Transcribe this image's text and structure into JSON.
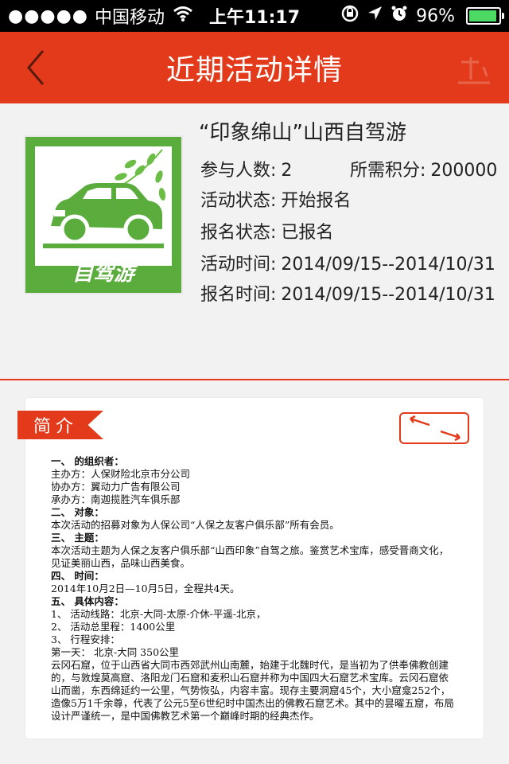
{
  "status_bar": {
    "signal": "●●●●●",
    "carrier": "中国移动",
    "wifi_icon": "wifi-icon",
    "time": "上午11:17",
    "battery": "96%"
  },
  "nav": {
    "back_icon": "chevron-left-icon",
    "title": "近期活动详情"
  },
  "activity": {
    "thumb_label": "自驾游",
    "title": "“印象绵山”山西自驾游",
    "participants_label": "参与人数:",
    "participants": "2",
    "points_label": "所需积分:",
    "points": "200000",
    "status_label": "活动状态:",
    "status": "开始报名",
    "signup_label": "报名状态:",
    "signup": "已报名",
    "time_label": "活动时间:",
    "time": "2014/09/15--2014/10/31",
    "signup_time_label": "报名时间:",
    "signup_time": "2014/09/15--2014/10/31"
  },
  "intro": {
    "tag": "简介",
    "lines": [
      {
        "t": "一、 的组织者：",
        "bold": true
      },
      {
        "t": "主办方：人保财险北京市分公司",
        "bold": false
      },
      {
        "t": "协办方：翼动力广告有限公司",
        "bold": false
      },
      {
        "t": "承办方：南迦揽胜汽车俱乐部",
        "bold": false
      },
      {
        "t": "二、 对象：",
        "bold": true
      },
      {
        "t": "本次活动的招募对象为人保公司“人保之友客户俱乐部”所有会员。",
        "bold": false
      },
      {
        "t": "三、 主题：",
        "bold": true
      },
      {
        "t": "本次活动主题为人保之友客户俱乐部“山西印象”自驾之旅。鉴赏艺术宝库，感受晋商文化，",
        "bold": false
      },
      {
        "t": "见证美丽山西，品味山西美食。",
        "bold": false
      },
      {
        "t": "四、 时间：",
        "bold": true
      },
      {
        "t": "2014年10月2日—10月5日，全程共4天。",
        "bold": false
      },
      {
        "t": "五、 具体内容：",
        "bold": true
      },
      {
        "t": "1、 活动线路：北京-大同-太原-介休-平遥-北京，",
        "bold": false
      },
      {
        "t": "2、 活动总里程：1400公里",
        "bold": false
      },
      {
        "t": "3、 行程安排：",
        "bold": false
      },
      {
        "t": "第一天： 北京-大同 350公里",
        "bold": false
      },
      {
        "t": "云冈石窟，位于山西省大同市西郊武州山南麓，始建于北魏时代，是当初为了供奉佛教创建",
        "bold": false
      },
      {
        "t": "的，与敦煌莫高窟、洛阳龙门石窟和麦积山石窟并称为中国四大石窟艺术宝库。云冈石窟依",
        "bold": false
      },
      {
        "t": "山而凿，东西绵延约一公里，气势恢弘，内容丰富。现存主要洞窟45个，大小窟龛252个，",
        "bold": false
      },
      {
        "t": "造像5万1千余尊，代表了公元5至6世纪时中国杰出的佛教石窟艺术。其中的昙曜五窟，布局",
        "bold": false
      },
      {
        "t": "设计严谨统一，是中国佛教艺术第一个巅峰时期的经典杰作。",
        "bold": false
      }
    ]
  }
}
